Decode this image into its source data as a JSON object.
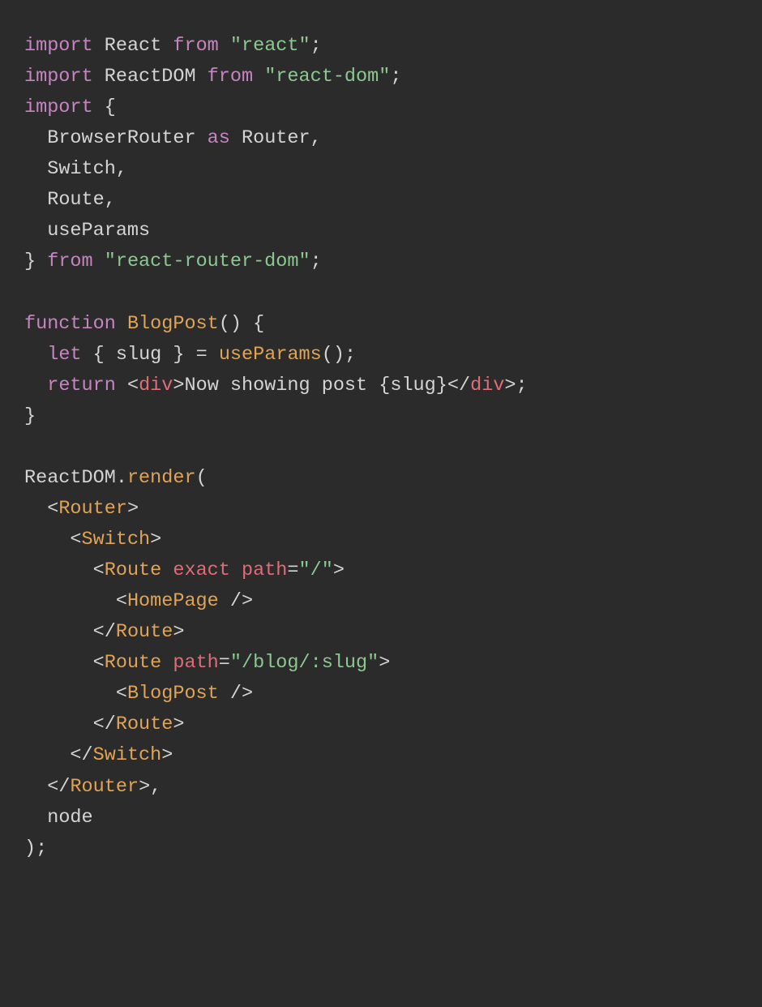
{
  "colors": {
    "background": "#2b2b2b",
    "default": "#d4d4d4",
    "keyword": "#c586c0",
    "string": "#8dc891",
    "function": "#e0a456",
    "tag": "#e0a456",
    "htmlTag": "#e06c75",
    "attribute": "#e06c75"
  },
  "code": {
    "language": "jsx",
    "lines": [
      {
        "tokens": [
          {
            "t": "import",
            "c": "keyword"
          },
          {
            "t": " "
          },
          {
            "t": "React",
            "c": "ident"
          },
          {
            "t": " "
          },
          {
            "t": "from",
            "c": "keyword"
          },
          {
            "t": " "
          },
          {
            "t": "\"react\"",
            "c": "string"
          },
          {
            "t": ";",
            "c": "punct"
          }
        ]
      },
      {
        "tokens": [
          {
            "t": "import",
            "c": "keyword"
          },
          {
            "t": " "
          },
          {
            "t": "ReactDOM",
            "c": "ident"
          },
          {
            "t": " "
          },
          {
            "t": "from",
            "c": "keyword"
          },
          {
            "t": " "
          },
          {
            "t": "\"react-dom\"",
            "c": "string"
          },
          {
            "t": ";",
            "c": "punct"
          }
        ]
      },
      {
        "tokens": [
          {
            "t": "import",
            "c": "keyword"
          },
          {
            "t": " "
          },
          {
            "t": "{",
            "c": "punct"
          }
        ]
      },
      {
        "tokens": [
          {
            "t": "  "
          },
          {
            "t": "BrowserRouter",
            "c": "ident"
          },
          {
            "t": " "
          },
          {
            "t": "as",
            "c": "keyword"
          },
          {
            "t": " "
          },
          {
            "t": "Router",
            "c": "ident"
          },
          {
            "t": ",",
            "c": "punct"
          }
        ]
      },
      {
        "tokens": [
          {
            "t": "  "
          },
          {
            "t": "Switch",
            "c": "ident"
          },
          {
            "t": ",",
            "c": "punct"
          }
        ]
      },
      {
        "tokens": [
          {
            "t": "  "
          },
          {
            "t": "Route",
            "c": "ident"
          },
          {
            "t": ",",
            "c": "punct"
          }
        ]
      },
      {
        "tokens": [
          {
            "t": "  "
          },
          {
            "t": "useParams",
            "c": "ident"
          }
        ]
      },
      {
        "tokens": [
          {
            "t": "}",
            "c": "punct"
          },
          {
            "t": " "
          },
          {
            "t": "from",
            "c": "keyword"
          },
          {
            "t": " "
          },
          {
            "t": "\"react-router-dom\"",
            "c": "string"
          },
          {
            "t": ";",
            "c": "punct"
          }
        ]
      },
      {
        "tokens": []
      },
      {
        "tokens": [
          {
            "t": "function",
            "c": "keyword"
          },
          {
            "t": " "
          },
          {
            "t": "BlogPost",
            "c": "function"
          },
          {
            "t": "()",
            "c": "punct"
          },
          {
            "t": " "
          },
          {
            "t": "{",
            "c": "punct"
          }
        ]
      },
      {
        "tokens": [
          {
            "t": "  "
          },
          {
            "t": "let",
            "c": "keyword"
          },
          {
            "t": " "
          },
          {
            "t": "{",
            "c": "punct"
          },
          {
            "t": " "
          },
          {
            "t": "slug",
            "c": "ident"
          },
          {
            "t": " "
          },
          {
            "t": "}",
            "c": "punct"
          },
          {
            "t": " "
          },
          {
            "t": "=",
            "c": "punct"
          },
          {
            "t": " "
          },
          {
            "t": "useParams",
            "c": "function"
          },
          {
            "t": "()",
            "c": "punct"
          },
          {
            "t": ";",
            "c": "punct"
          }
        ]
      },
      {
        "tokens": [
          {
            "t": "  "
          },
          {
            "t": "return",
            "c": "keyword"
          },
          {
            "t": " "
          },
          {
            "t": "<",
            "c": "punct"
          },
          {
            "t": "div",
            "c": "htmlTag"
          },
          {
            "t": ">",
            "c": "punct"
          },
          {
            "t": "Now showing post ",
            "c": "ident"
          },
          {
            "t": "{",
            "c": "punct"
          },
          {
            "t": "slug",
            "c": "ident"
          },
          {
            "t": "}",
            "c": "punct"
          },
          {
            "t": "</",
            "c": "punct"
          },
          {
            "t": "div",
            "c": "htmlTag"
          },
          {
            "t": ">",
            "c": "punct"
          },
          {
            "t": ";",
            "c": "punct"
          }
        ]
      },
      {
        "tokens": [
          {
            "t": "}",
            "c": "punct"
          }
        ]
      },
      {
        "tokens": []
      },
      {
        "tokens": [
          {
            "t": "ReactDOM",
            "c": "ident"
          },
          {
            "t": ".",
            "c": "punct"
          },
          {
            "t": "render",
            "c": "function"
          },
          {
            "t": "(",
            "c": "punct"
          }
        ]
      },
      {
        "tokens": [
          {
            "t": "  "
          },
          {
            "t": "<",
            "c": "punct"
          },
          {
            "t": "Router",
            "c": "tag"
          },
          {
            "t": ">",
            "c": "punct"
          }
        ]
      },
      {
        "tokens": [
          {
            "t": "    "
          },
          {
            "t": "<",
            "c": "punct"
          },
          {
            "t": "Switch",
            "c": "tag"
          },
          {
            "t": ">",
            "c": "punct"
          }
        ]
      },
      {
        "tokens": [
          {
            "t": "      "
          },
          {
            "t": "<",
            "c": "punct"
          },
          {
            "t": "Route",
            "c": "tag"
          },
          {
            "t": " "
          },
          {
            "t": "exact",
            "c": "attribute"
          },
          {
            "t": " "
          },
          {
            "t": "path",
            "c": "attribute"
          },
          {
            "t": "=",
            "c": "punct"
          },
          {
            "t": "\"/\"",
            "c": "string"
          },
          {
            "t": ">",
            "c": "punct"
          }
        ]
      },
      {
        "tokens": [
          {
            "t": "        "
          },
          {
            "t": "<",
            "c": "punct"
          },
          {
            "t": "HomePage",
            "c": "tag"
          },
          {
            "t": " />",
            "c": "punct"
          }
        ]
      },
      {
        "tokens": [
          {
            "t": "      "
          },
          {
            "t": "</",
            "c": "punct"
          },
          {
            "t": "Route",
            "c": "tag"
          },
          {
            "t": ">",
            "c": "punct"
          }
        ]
      },
      {
        "tokens": [
          {
            "t": "      "
          },
          {
            "t": "<",
            "c": "punct"
          },
          {
            "t": "Route",
            "c": "tag"
          },
          {
            "t": " "
          },
          {
            "t": "path",
            "c": "attribute"
          },
          {
            "t": "=",
            "c": "punct"
          },
          {
            "t": "\"/blog/:slug\"",
            "c": "string"
          },
          {
            "t": ">",
            "c": "punct"
          }
        ]
      },
      {
        "tokens": [
          {
            "t": "        "
          },
          {
            "t": "<",
            "c": "punct"
          },
          {
            "t": "BlogPost",
            "c": "tag"
          },
          {
            "t": " />",
            "c": "punct"
          }
        ]
      },
      {
        "tokens": [
          {
            "t": "      "
          },
          {
            "t": "</",
            "c": "punct"
          },
          {
            "t": "Route",
            "c": "tag"
          },
          {
            "t": ">",
            "c": "punct"
          }
        ]
      },
      {
        "tokens": [
          {
            "t": "    "
          },
          {
            "t": "</",
            "c": "punct"
          },
          {
            "t": "Switch",
            "c": "tag"
          },
          {
            "t": ">",
            "c": "punct"
          }
        ]
      },
      {
        "tokens": [
          {
            "t": "  "
          },
          {
            "t": "</",
            "c": "punct"
          },
          {
            "t": "Router",
            "c": "tag"
          },
          {
            "t": ">",
            "c": "punct"
          },
          {
            "t": ",",
            "c": "punct"
          }
        ]
      },
      {
        "tokens": [
          {
            "t": "  "
          },
          {
            "t": "node",
            "c": "ident"
          }
        ]
      },
      {
        "tokens": [
          {
            "t": ")",
            "c": "punct"
          },
          {
            "t": ";",
            "c": "punct"
          }
        ]
      }
    ]
  }
}
